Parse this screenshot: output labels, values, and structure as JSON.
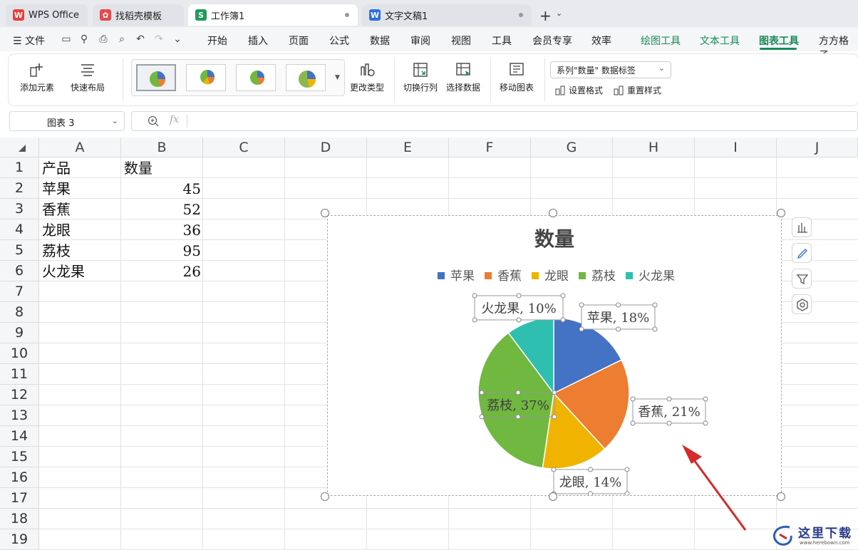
{
  "tabs": [
    {
      "label": "WPS Office",
      "logo": "W",
      "color": "#e8403d"
    },
    {
      "label": "找稻壳模板",
      "logo": "",
      "color": "#e24b4b"
    },
    {
      "label": "工作簿1",
      "logo": "S",
      "color": "#1f9a5c"
    },
    {
      "label": "文字文稿1",
      "logo": "W",
      "color": "#2f6fde"
    }
  ],
  "menu": {
    "file": "文件",
    "items": [
      "开始",
      "插入",
      "页面",
      "公式",
      "数据",
      "审阅",
      "视图",
      "工具",
      "会员专享",
      "效率"
    ],
    "context_items": [
      "绘图工具",
      "文本工具",
      "图表工具",
      "方方格子"
    ],
    "active": "图表工具"
  },
  "ribbon": {
    "add_element": "添加元素",
    "quick_layout": "快速布局",
    "change_type": "更改类型",
    "switch_rowcol": "切换行列",
    "select_data": "选择数据",
    "move_chart": "移动图表",
    "series_select": "系列\"数量\" 数据标签",
    "set_format": "设置格式",
    "reset_style": "重置样式"
  },
  "formula_bar": {
    "name_box": "图表 3",
    "fx": "fx",
    "value": ""
  },
  "grid": {
    "columns": [
      "A",
      "B",
      "C",
      "D",
      "E",
      "F",
      "G",
      "H",
      "I",
      "J"
    ],
    "rows": [
      "1",
      "2",
      "3",
      "4",
      "5",
      "6",
      "7",
      "8",
      "9",
      "10",
      "11",
      "12",
      "13",
      "14",
      "15",
      "16",
      "17",
      "18",
      "19"
    ],
    "header": {
      "a": "产品",
      "b": "数量"
    },
    "data": [
      {
        "a": "苹果",
        "b": "45"
      },
      {
        "a": "香蕉",
        "b": "52"
      },
      {
        "a": "龙眼",
        "b": "36"
      },
      {
        "a": "荔枝",
        "b": "95"
      },
      {
        "a": "火龙果",
        "b": "26"
      }
    ]
  },
  "chart_data": {
    "type": "pie",
    "title": "数量",
    "categories": [
      "苹果",
      "香蕉",
      "龙眼",
      "荔枝",
      "火龙果"
    ],
    "values": [
      45,
      52,
      36,
      95,
      26
    ],
    "colors": [
      "#4472c4",
      "#ed7d31",
      "#f0b400",
      "#70b83f",
      "#2ebfb0"
    ],
    "data_labels": [
      "苹果, 18%",
      "香蕉, 21%",
      "龙眼, 14%",
      "荔枝, 37%",
      "火龙果, 10%"
    ],
    "legend_position": "top"
  },
  "watermark": {
    "text": "这里下载",
    "sub": "www.herebown.com"
  }
}
